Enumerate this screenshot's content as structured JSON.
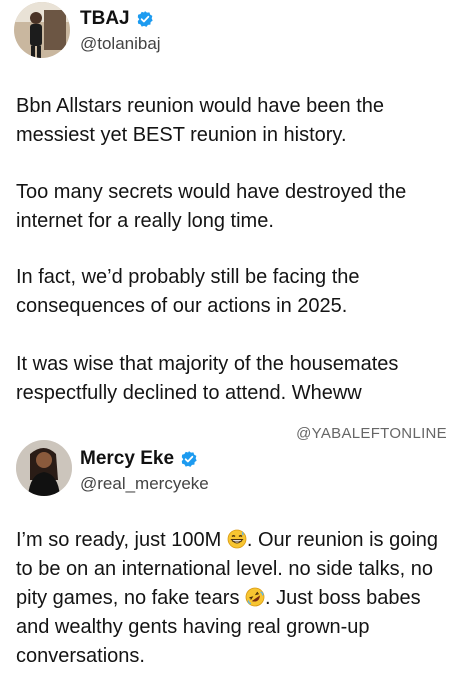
{
  "post1": {
    "display_name": "TBAJ",
    "handle": "@tolanibaj",
    "paragraphs": [
      "Bbn Allstars reunion would have been the messiest yet BEST reunion in history.",
      "Too many secrets would have destroyed the internet for a really long time.",
      "In fact, we’d probably still be facing the consequences of our actions in 2025.",
      "It was wise that majority of the housemates respectfully declined to attend. Wheww"
    ]
  },
  "watermark": "@YABALEFTONLINE",
  "post2": {
    "display_name": "Mercy Eke",
    "handle": "@real_mercyeke",
    "text_part1": "I’m so ready, just 100M ",
    "emoji1": "grinning-sweat-emoji",
    "text_part2": ". Our reunion is going to be on an international level. no side talks, no pity games, no fake tears ",
    "emoji2": "rofl-emoji",
    "text_part3": ". Just boss babes and wealthy gents having real grown-up conversations."
  },
  "colors": {
    "verified": "#1d9bf0",
    "text": "#141414",
    "handle": "#444444"
  }
}
